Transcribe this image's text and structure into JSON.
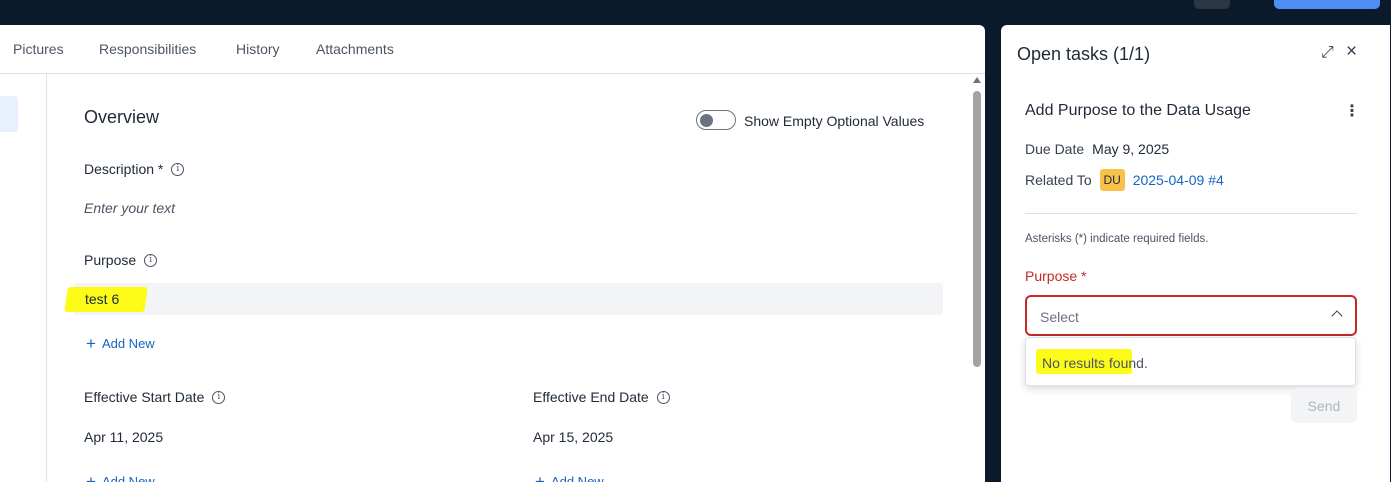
{
  "tabs": [
    "Pictures",
    "Responsibilities",
    "History",
    "Attachments"
  ],
  "overview": {
    "title": "Overview",
    "toggle_label": "Show Empty Optional Values",
    "description": {
      "label": "Description *",
      "placeholder": "Enter your text"
    },
    "purpose": {
      "label": "Purpose",
      "value": "test 6",
      "add_new": "Add New"
    },
    "effective_start": {
      "label": "Effective Start Date",
      "value": "Apr 11, 2025",
      "add_new": "Add New"
    },
    "effective_end": {
      "label": "Effective End Date",
      "value": "Apr 15, 2025",
      "add_new": "Add New"
    }
  },
  "tasks_panel": {
    "title": "Open tasks (1/1)",
    "task": {
      "title": "Add Purpose to the Data Usage",
      "due_label": "Due Date",
      "due_value": "May 9, 2025",
      "related_label": "Related To",
      "related_badge": "DU",
      "related_link": "2025-04-09 #4"
    },
    "hint": "Asterisks (*) indicate required fields.",
    "field_label": "Purpose *",
    "select_placeholder": "Select",
    "no_results": "No results found.",
    "send_label": "Send"
  },
  "icons": {
    "info": "info-icon",
    "expand": "expand-icon",
    "close": "close-icon",
    "more": "kebab-icon",
    "plus": "plus-icon",
    "chevron": "chevron-up-icon"
  },
  "colors": {
    "accent": "#1565c0",
    "error": "#c62828",
    "highlight": "#fcfc18",
    "badge": "#f8c24a",
    "top_bar": "#0b1a2a"
  }
}
